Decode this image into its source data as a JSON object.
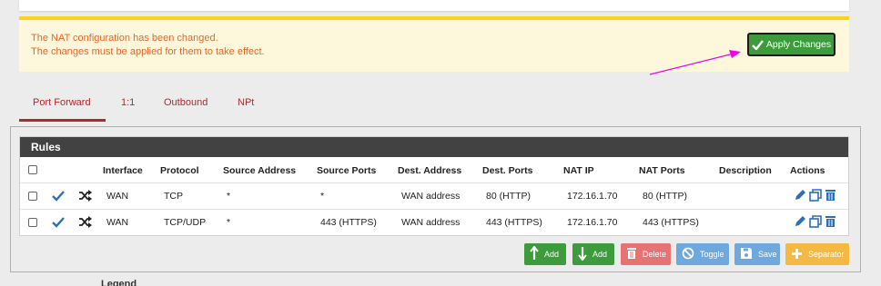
{
  "alert": {
    "line1": "The NAT configuration has been changed.",
    "line2": "The changes must be applied for them to take effect.",
    "apply_label": "Apply Changes"
  },
  "tabs": [
    {
      "label": "Port Forward",
      "active": true
    },
    {
      "label": "1:1",
      "active": false
    },
    {
      "label": "Outbound",
      "active": false
    },
    {
      "label": "NPt",
      "active": false
    }
  ],
  "rules": {
    "title": "Rules",
    "headers": [
      "Interface",
      "Protocol",
      "Source Address",
      "Source Ports",
      "Dest. Address",
      "Dest. Ports",
      "NAT IP",
      "NAT Ports",
      "Description",
      "Actions"
    ],
    "rows": [
      {
        "interface": "WAN",
        "protocol": "TCP",
        "source_address": "*",
        "source_ports": "*",
        "dest_address": "WAN address",
        "dest_ports": "80 (HTTP)",
        "nat_ip": "172.16.1.70",
        "nat_ports": "80 (HTTP)",
        "description": ""
      },
      {
        "interface": "WAN",
        "protocol": "TCP/UDP",
        "source_address": "*",
        "source_ports": "443 (HTTPS)",
        "dest_address": "WAN address",
        "dest_ports": "443 (HTTPS)",
        "nat_ip": "172.16.1.70",
        "nat_ports": "443 (HTTPS)",
        "description": ""
      }
    ]
  },
  "buttons": {
    "add_top": "Add",
    "add_bottom": "Add",
    "delete": "Delete",
    "toggle": "Toggle",
    "save": "Save",
    "separator": "Separator"
  },
  "legend": {
    "title": "Legend"
  },
  "colors": {
    "alert_bg": "#fdf8dc",
    "alert_border": "#ffd21c",
    "alert_text": "#e7662b",
    "success": "#3c9c3c",
    "danger": "#e57373",
    "info": "#6fa8dc",
    "warning": "#f4b942",
    "tab_active": "#b1282c",
    "annotation": "#ee00ee"
  }
}
